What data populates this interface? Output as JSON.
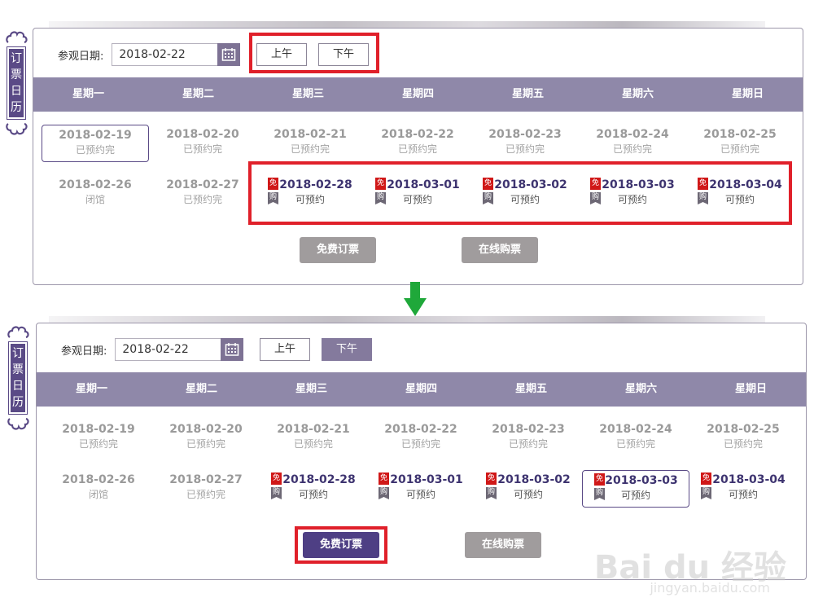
{
  "side_tab": {
    "chars": [
      "订",
      "票",
      "日",
      "历"
    ]
  },
  "date_label": "参观日期:",
  "date_value": "2018-02-22",
  "am_label": "上午",
  "pm_label": "下午",
  "weekdays": [
    "星期一",
    "星期二",
    "星期三",
    "星期四",
    "星期五",
    "星期六",
    "星期日"
  ],
  "badges": {
    "free": "免",
    "buy": "购"
  },
  "top_panel": {
    "active_period": "none",
    "rows": [
      [
        {
          "date": "2018-02-19",
          "status": "已预约完"
        },
        {
          "date": "2018-02-20",
          "status": "已预约完"
        },
        {
          "date": "2018-02-21",
          "status": "已预约完"
        },
        {
          "date": "2018-02-22",
          "status": "已预约完"
        },
        {
          "date": "2018-02-23",
          "status": "已预约完"
        },
        {
          "date": "2018-02-24",
          "status": "已预约完"
        },
        {
          "date": "2018-02-25",
          "status": "已预约完"
        }
      ],
      [
        {
          "date": "2018-02-26",
          "status": "闭馆"
        },
        {
          "date": "2018-02-27",
          "status": "已预约完"
        },
        {
          "date": "2018-02-28",
          "status": "可预约"
        },
        {
          "date": "2018-03-01",
          "status": "可预约"
        },
        {
          "date": "2018-03-02",
          "status": "可预约"
        },
        {
          "date": "2018-03-03",
          "status": "可预约"
        },
        {
          "date": "2018-03-04",
          "status": "可预约"
        }
      ]
    ],
    "selected_date": "2018-02-19"
  },
  "bottom_panel": {
    "active_period": "pm",
    "selected_date": "2018-03-03"
  },
  "buttons": {
    "free": "免费订票",
    "online": "在线购票"
  },
  "watermark": {
    "main": "Bai du 经验",
    "sub": "jingyan.baidu.com"
  },
  "colors": {
    "accent": "#5a4a86",
    "header": "#8f88a9",
    "highlight": "#e0202a",
    "arrow": "#1fa83a",
    "free_badge": "#d01818"
  }
}
